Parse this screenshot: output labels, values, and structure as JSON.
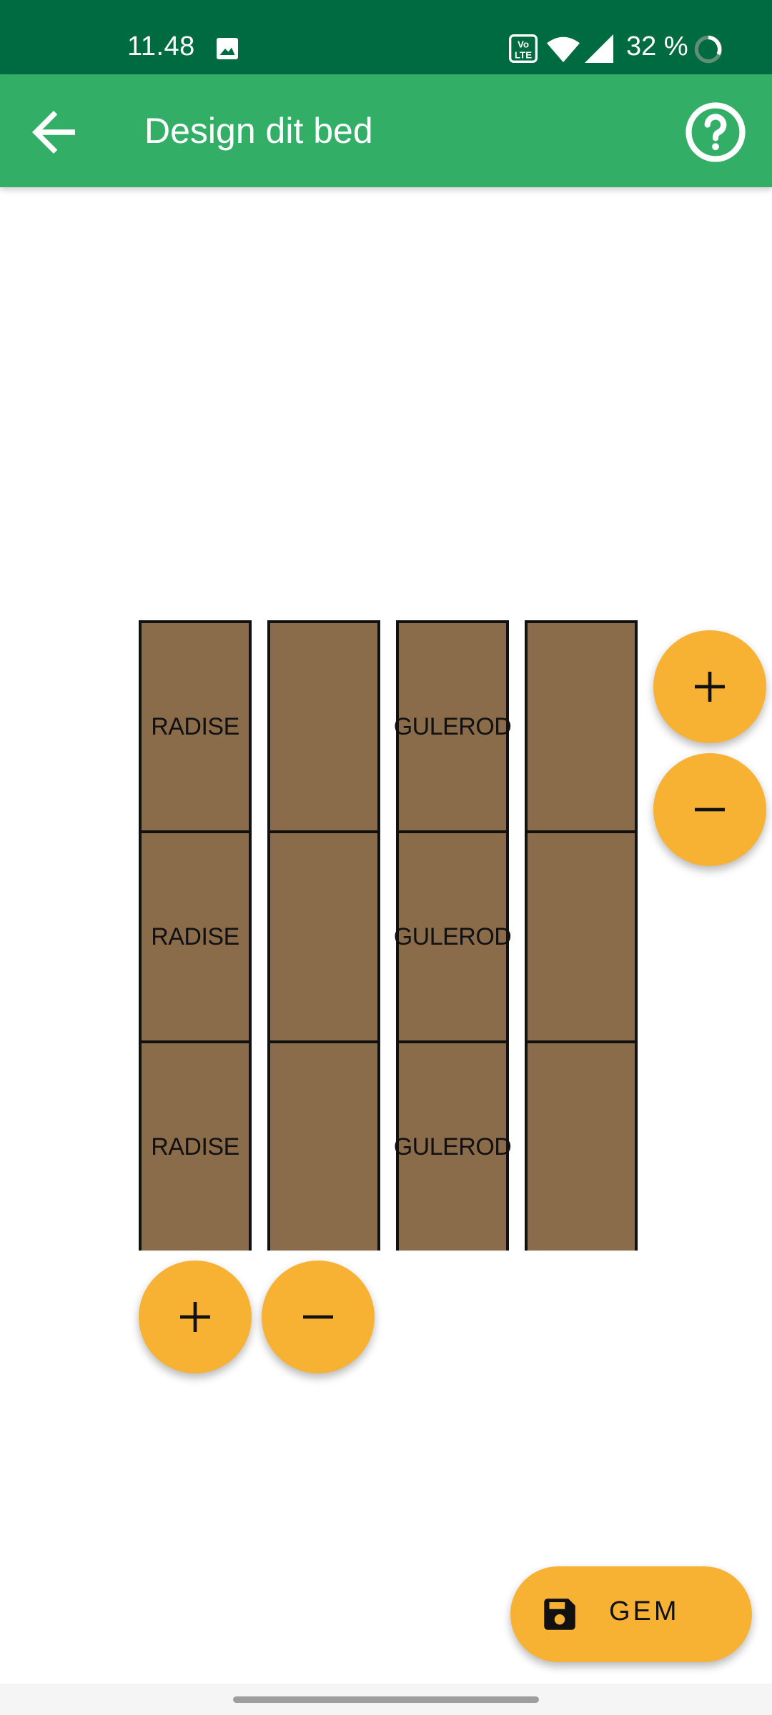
{
  "status_bar": {
    "time": "11.48",
    "battery": "32 %",
    "icons": [
      "gallery-icon",
      "volte-icon",
      "wifi-icon",
      "signal-icon",
      "battery-icon"
    ]
  },
  "app_bar": {
    "title": "Design dit bed",
    "back_icon": "arrow-back-icon",
    "help_icon": "help-circle-icon"
  },
  "bed": {
    "columns": [
      {
        "cells": [
          "RADISE",
          "RADISE",
          "RADISE"
        ]
      },
      {
        "cells": [
          "",
          "",
          ""
        ]
      },
      {
        "cells": [
          "GULEROD",
          "GULEROD",
          "GULEROD"
        ]
      },
      {
        "cells": [
          "",
          "",
          ""
        ]
      }
    ]
  },
  "controls": {
    "add_row_icon": "plus-icon",
    "remove_row_icon": "minus-icon",
    "add_column_icon": "plus-icon",
    "remove_column_icon": "minus-icon"
  },
  "save_button": {
    "label": "GEM",
    "icon": "save-icon"
  },
  "colors": {
    "status_bar": "#006b40",
    "app_bar": "#33ae67",
    "soil": "#8a6c4b",
    "accent": "#f7b234"
  }
}
